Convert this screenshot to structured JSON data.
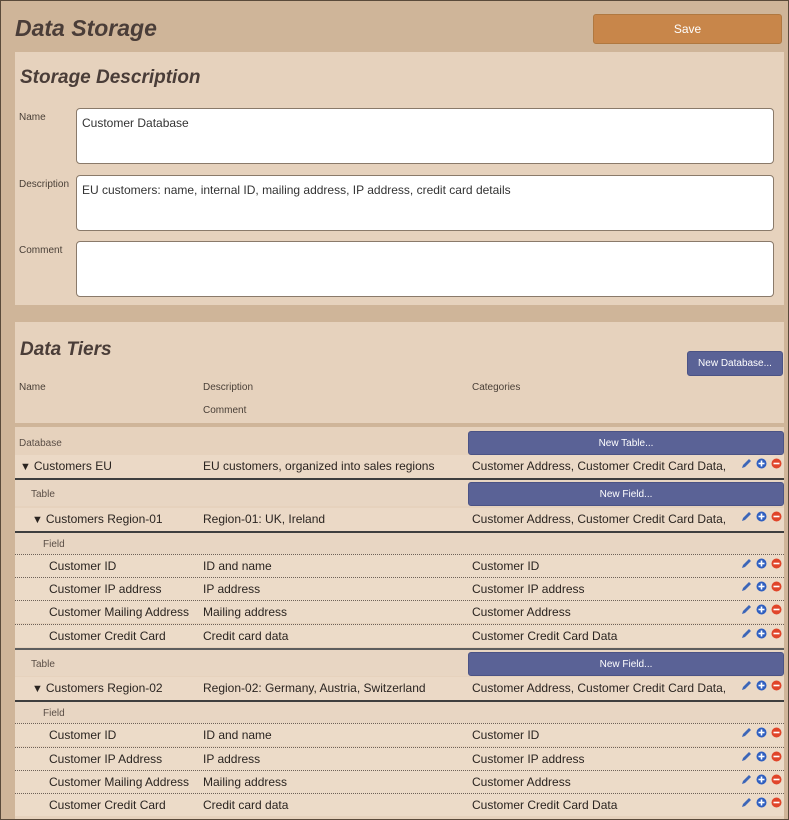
{
  "title": "Data Storage",
  "save_label": "Save",
  "storage": {
    "title": "Storage Description",
    "name_label": "Name",
    "name_value": "Customer Database",
    "description_label": "Description",
    "description_value": "EU customers: name, internal ID, mailing address, IP address, credit card details",
    "comment_label": "Comment",
    "comment_value": ""
  },
  "tiers": {
    "title": "Data Tiers",
    "new_database_label": "New Database...",
    "col_name": "Name",
    "col_description": "Description",
    "col_comment": "Comment",
    "col_categories": "Categories",
    "database_label": "Database",
    "new_table_label": "New Table...",
    "database": {
      "name": "Customers EU",
      "description": "EU customers, organized into sales regions",
      "categories": "Customer Address, Customer Credit Card Data,"
    },
    "table_label": "Table",
    "new_field_label": "New Field...",
    "field_label": "Field",
    "tables": [
      {
        "name": "Customers Region-01",
        "description": "Region-01: UK, Ireland",
        "categories": "Customer Address, Customer Credit Card Data,",
        "fields": [
          {
            "name": "Customer ID",
            "description": "ID and name",
            "categories": "Customer ID"
          },
          {
            "name": "Customer IP address",
            "description": "IP address",
            "categories": "Customer IP address"
          },
          {
            "name": "Customer Mailing Address",
            "description": "Mailing address",
            "categories": "Customer Address"
          },
          {
            "name": "Customer Credit Card",
            "description": "Credit card data",
            "categories": "Customer Credit Card Data"
          }
        ]
      },
      {
        "name": "Customers Region-02",
        "description": "Region-02: Germany, Austria, Switzerland",
        "categories": "Customer Address, Customer Credit Card Data,",
        "fields": [
          {
            "name": "Customer ID",
            "description": "ID and name",
            "categories": "Customer ID"
          },
          {
            "name": "Customer IP Address",
            "description": "IP address",
            "categories": "Customer IP address"
          },
          {
            "name": "Customer Mailing Address",
            "description": "Mailing address",
            "categories": "Customer Address"
          },
          {
            "name": "Customer Credit Card",
            "description": "Credit card data",
            "categories": "Customer Credit Card Data"
          }
        ]
      }
    ]
  },
  "colors": {
    "background": "#cfb599",
    "panel": "#e6d2bd",
    "save_button": "#c8864a",
    "purple_button": "#5a6296",
    "edit_icon": "#3c66b8",
    "add_icon": "#2f5fc0",
    "delete_icon": "#e0452a"
  },
  "icons": {
    "row_actions": [
      "pencil-icon",
      "add-circle-icon",
      "remove-circle-icon"
    ],
    "expand": "triangle-down-icon"
  }
}
